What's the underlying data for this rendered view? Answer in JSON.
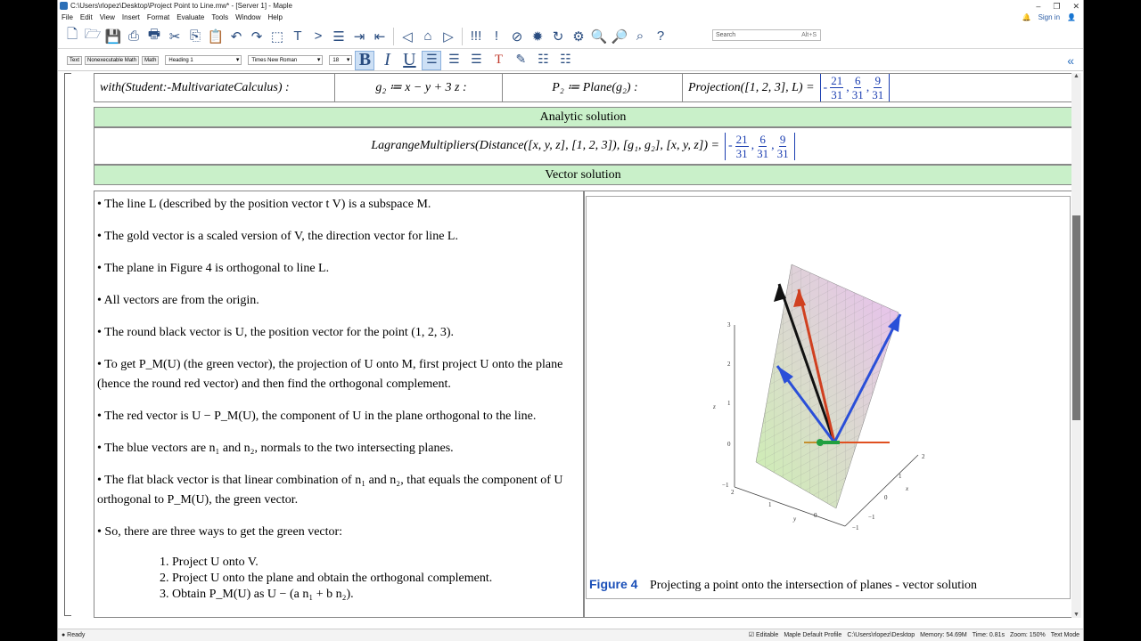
{
  "window": {
    "title": "C:\\Users\\rlopez\\Desktop\\Project Point to Line.mw* - [Server 1] - Maple",
    "controls": [
      "–",
      "❐",
      "✕"
    ]
  },
  "menu": [
    "File",
    "Edit",
    "View",
    "Insert",
    "Format",
    "Evaluate",
    "Tools",
    "Window",
    "Help"
  ],
  "account": {
    "signin": "Sign in"
  },
  "search": {
    "placeholder": "Search",
    "shortcut": "Alt+S"
  },
  "format_bar": {
    "modes": [
      "Text",
      "Nonexecutable Math",
      "Math"
    ],
    "style": "Heading 1",
    "font": "Times New Roman",
    "size": "18"
  },
  "math_row": {
    "c1": "with(Student:-MultivariateCalculus) :",
    "c2": "g₂ ≔ x − y + 3 z :",
    "c3": "P₂ ≔ Plane(g₂) :",
    "c4_lhs": "Projection([1, 2, 3], L) =",
    "result": {
      "sign": "-",
      "a_num": "21",
      "a_den": "31",
      "b_num": "6",
      "b_den": "31",
      "c_num": "9",
      "c_den": "31"
    }
  },
  "analytic": {
    "title": "Analytic solution",
    "expr": "LagrangeMultipliers(Distance([x, y, z], [1, 2, 3]), [g₁, g₂], [x, y, z]) ="
  },
  "vector": {
    "title": "Vector solution"
  },
  "bullets": [
    "• The line L (described by the position vector t V) is a subspace M.",
    "• The gold vector is a scaled version of V, the direction vector for line L.",
    "• The plane in Figure 4 is orthogonal to line L.",
    "• All vectors  are from the origin.",
    "• The round black vector is U, the position vector for the point (1, 2, 3).",
    "• To get P_M(U) (the green vector), the projection of U onto M, first project U onto the plane (hence the round red vector) and then find the orthogonal complement.",
    "• The red vector is U − P_M(U), the component of U in the plane orthogonal to the line.",
    "• The blue vectors are n₁ and n₂, normals to the two intersecting planes.",
    "• The flat black vector is that linear combination of n₁ and n₂, that equals the component of U orthogonal to P_M(U), the green vector.",
    "• So, there are three ways to get the green vector:"
  ],
  "steps": [
    "1. Project U onto V.",
    "2. Project U onto the plane and obtain the orthogonal complement.",
    "3. Obtain P_M(U) as U − (a n₁ + b n₂)."
  ],
  "figure": {
    "label": "Figure 4",
    "caption": "Projecting a point onto the intersection of planes - vector solution",
    "axis_z": "z",
    "axis_x": "x",
    "axis_y": "y",
    "z_ticks": [
      "3",
      "2",
      "1",
      "0",
      "−1"
    ],
    "x_ticks": [
      "2",
      "1",
      "0",
      "−1"
    ],
    "y_ticks": [
      "2",
      "1",
      "0",
      "−1"
    ]
  },
  "status": {
    "left": "● Ready",
    "items": [
      "☑ Editable",
      "Maple Default Profile",
      "C:\\Users\\rlopez\\Desktop",
      "Memory: 54.69M",
      "Time: 0.81s",
      "Zoom: 150%",
      "Text Mode"
    ]
  }
}
